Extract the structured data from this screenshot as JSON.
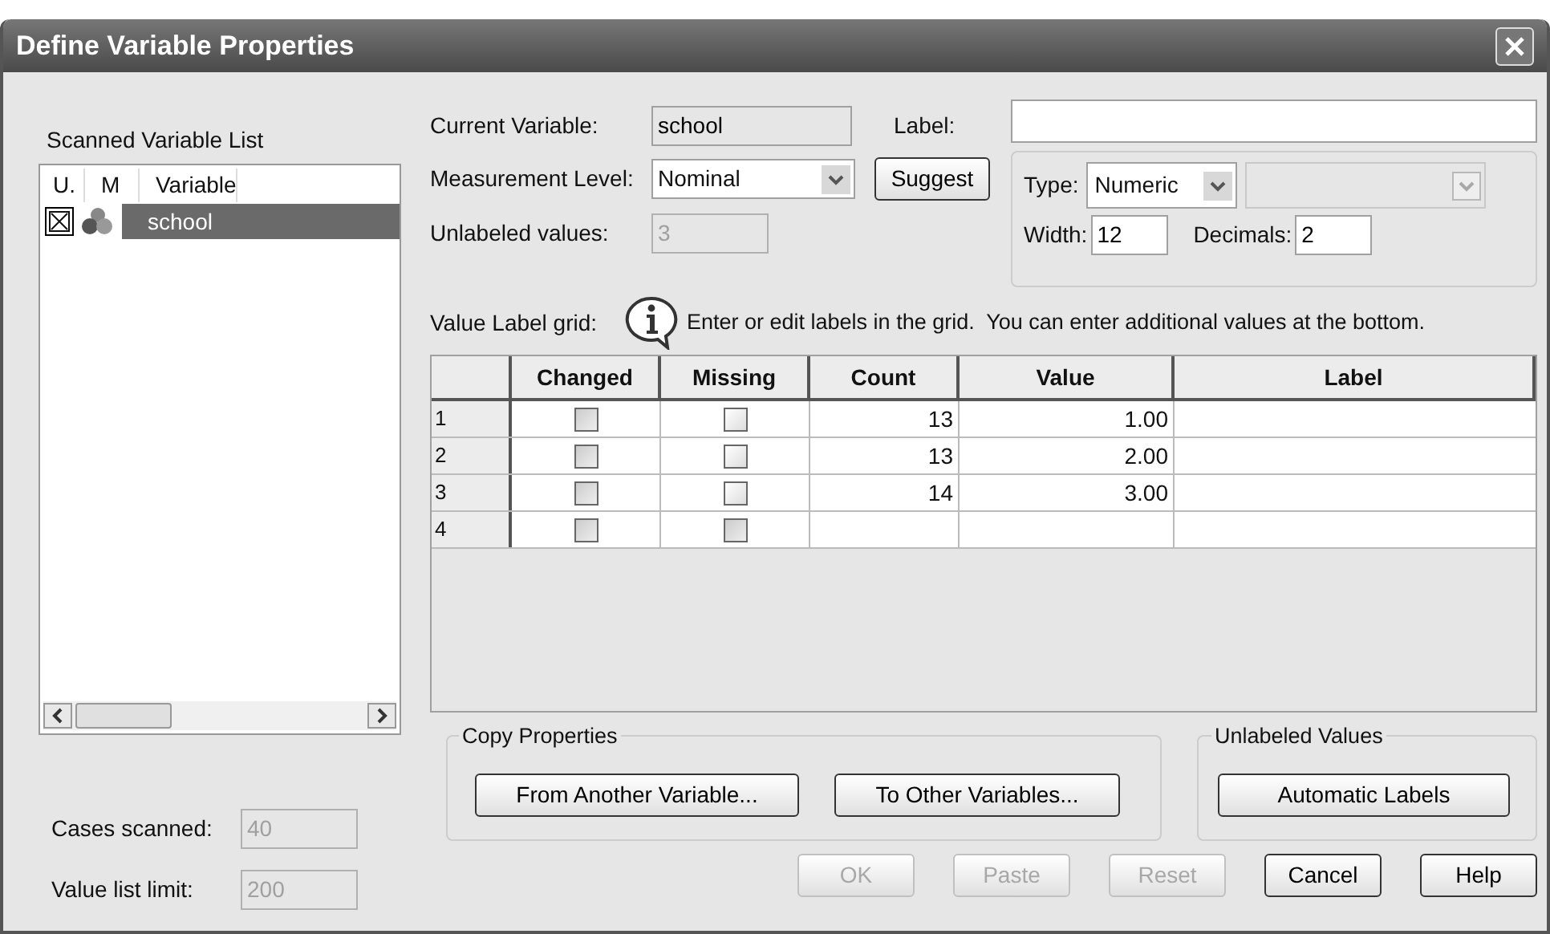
{
  "window": {
    "title": "Define Variable Properties"
  },
  "scanned_list": {
    "title": "Scanned Variable List",
    "columns": [
      "U.",
      "M",
      "Variable"
    ],
    "rows": [
      {
        "unlabeled_checked": true,
        "name": "school",
        "selected": true
      }
    ]
  },
  "cases_scanned": {
    "label": "Cases scanned:",
    "value": "40",
    "disabled": true
  },
  "value_list_limit": {
    "label": "Value list limit:",
    "value": "200",
    "disabled": true
  },
  "current_variable": {
    "label": "Current Variable:",
    "value": "school"
  },
  "label_field": {
    "label": "Label:"
  },
  "measurement_level": {
    "label": "Measurement Level:",
    "value": "Nominal"
  },
  "suggest_button": "Suggest",
  "unlabeled_values": {
    "label": "Unlabeled values:",
    "value": "3",
    "disabled": true
  },
  "type": {
    "label": "Type:",
    "value": "Numeric"
  },
  "width": {
    "label": "Width:",
    "value": "12"
  },
  "decimals": {
    "label": "Decimals:",
    "value": "2"
  },
  "grid_label": "Value Label grid:",
  "grid_hint": "Enter or edit labels in the grid.  You can enter additional values at the bottom.",
  "grid": {
    "columns": [
      "Changed",
      "Missing",
      "Count",
      "Value",
      "Label"
    ],
    "rows": [
      {
        "row": "1",
        "changed_disabled": true,
        "missing_disabled": false,
        "count": "13",
        "value": "1.00"
      },
      {
        "row": "2",
        "changed_disabled": true,
        "missing_disabled": false,
        "count": "13",
        "value": "2.00"
      },
      {
        "row": "3",
        "changed_disabled": true,
        "missing_disabled": false,
        "count": "14",
        "value": "3.00"
      },
      {
        "row": "4",
        "changed_disabled": true,
        "missing_disabled": true
      }
    ]
  },
  "copy_properties": {
    "title": "Copy Properties",
    "buttons": [
      "From Another Variable...",
      "To Other Variables..."
    ]
  },
  "unlabeled_group": {
    "title": "Unlabeled Values",
    "button": "Automatic Labels"
  },
  "footer_buttons": [
    {
      "label": "OK",
      "disabled": true
    },
    {
      "label": "Paste",
      "disabled": true
    },
    {
      "label": "Reset",
      "disabled": true
    },
    {
      "label": "Cancel",
      "disabled": false
    },
    {
      "label": "Help",
      "disabled": false
    }
  ]
}
